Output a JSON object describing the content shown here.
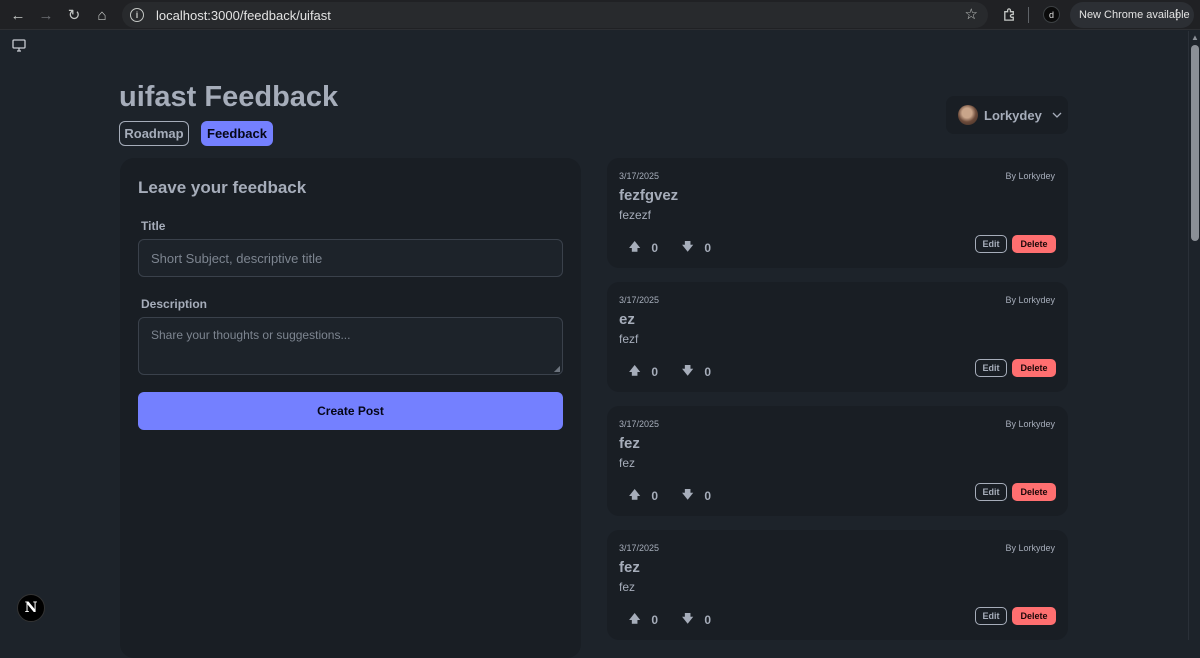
{
  "browser": {
    "back_icon": "←",
    "forward_icon": "→",
    "reload_icon": "↻",
    "home_icon": "⌂",
    "url": "localhost:3000/feedback/uifast",
    "profile_initial": "d",
    "update_label": "New Chrome available"
  },
  "page": {
    "title": "uifast Feedback",
    "tabs": [
      {
        "label": "Roadmap"
      },
      {
        "label": "Feedback"
      }
    ],
    "user": {
      "name": "Lorkydey"
    }
  },
  "form": {
    "heading": "Leave your feedback",
    "title_label": "Title",
    "title_placeholder": "Short Subject, descriptive title",
    "description_label": "Description",
    "description_placeholder": "Share your thoughts or suggestions...",
    "submit_label": "Create Post"
  },
  "posts": [
    {
      "date": "3/17/2025",
      "author": "By Lorkydey",
      "title": "fezfgvez",
      "description": "fezezf",
      "upvotes": "0",
      "downvotes": "0",
      "edit_label": "Edit",
      "delete_label": "Delete"
    },
    {
      "date": "3/17/2025",
      "author": "By Lorkydey",
      "title": "ez",
      "description": "fezf",
      "upvotes": "0",
      "downvotes": "0",
      "edit_label": "Edit",
      "delete_label": "Delete"
    },
    {
      "date": "3/17/2025",
      "author": "By Lorkydey",
      "title": "fez",
      "description": "fez",
      "upvotes": "0",
      "downvotes": "0",
      "edit_label": "Edit",
      "delete_label": "Delete"
    },
    {
      "date": "3/17/2025",
      "author": "By Lorkydey",
      "title": "fez",
      "description": "fez",
      "upvotes": "0",
      "downvotes": "0",
      "edit_label": "Edit",
      "delete_label": "Delete"
    }
  ],
  "colors": {
    "background": "#1d232a",
    "card": "#191e24",
    "primary": "#7480ff",
    "danger": "#ff6f70",
    "text": "#a6adba"
  },
  "icons": [
    "back-icon",
    "forward-icon",
    "reload-icon",
    "home-icon",
    "info-icon",
    "star-icon",
    "extensions-icon",
    "monitor-icon",
    "chevron-down-icon",
    "upvote-icon",
    "downvote-icon",
    "nextjs-icon"
  ]
}
